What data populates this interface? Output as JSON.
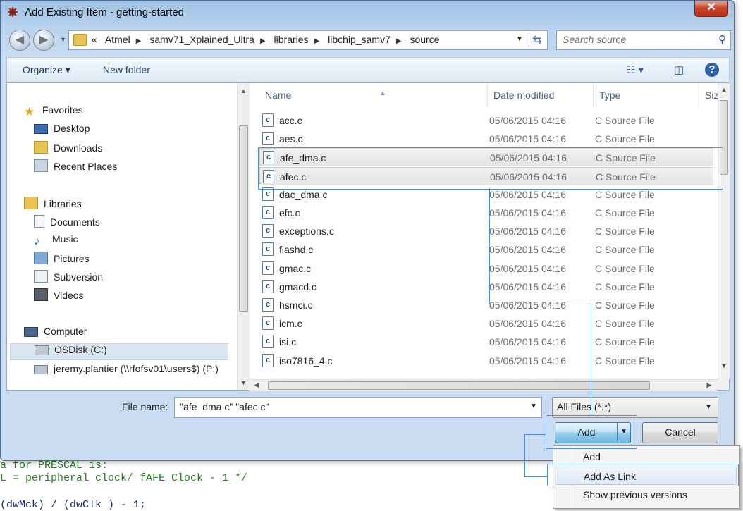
{
  "window": {
    "title": "Add Existing Item - getting-started",
    "close_glyph": "✕"
  },
  "nav": {
    "breadcrumbs": [
      "Atmel",
      "samv71_Xplained_Ultra",
      "libraries",
      "libchip_samv7",
      "source"
    ],
    "crumb_overflow": "«",
    "search_placeholder": "Search source"
  },
  "toolbar": {
    "organize": "Organize ▾",
    "new_folder": "New folder"
  },
  "sidebar": {
    "favorites": {
      "label": "Favorites",
      "items": [
        "Desktop",
        "Downloads",
        "Recent Places"
      ]
    },
    "libraries": {
      "label": "Libraries",
      "items": [
        "Documents",
        "Music",
        "Pictures",
        "Subversion",
        "Videos"
      ]
    },
    "computer": {
      "label": "Computer",
      "items": [
        "OSDisk (C:)",
        "jeremy.plantier (\\\\rfofsv01\\users$) (P:)"
      ]
    }
  },
  "columns": {
    "name": "Name",
    "date": "Date modified",
    "type": "Type",
    "size": "Siz"
  },
  "files": [
    {
      "name": "acc.c",
      "date": "05/06/2015 04:16",
      "type": "C Source File"
    },
    {
      "name": "aes.c",
      "date": "05/06/2015 04:16",
      "type": "C Source File"
    },
    {
      "name": "afe_dma.c",
      "date": "05/06/2015 04:16",
      "type": "C Source File"
    },
    {
      "name": "afec.c",
      "date": "05/06/2015 04:16",
      "type": "C Source File"
    },
    {
      "name": "dac_dma.c",
      "date": "05/06/2015 04:16",
      "type": "C Source File"
    },
    {
      "name": "efc.c",
      "date": "05/06/2015 04:16",
      "type": "C Source File"
    },
    {
      "name": "exceptions.c",
      "date": "05/06/2015 04:16",
      "type": "C Source File"
    },
    {
      "name": "flashd.c",
      "date": "05/06/2015 04:16",
      "type": "C Source File"
    },
    {
      "name": "gmac.c",
      "date": "05/06/2015 04:16",
      "type": "C Source File"
    },
    {
      "name": "gmacd.c",
      "date": "05/06/2015 04:16",
      "type": "C Source File"
    },
    {
      "name": "hsmci.c",
      "date": "05/06/2015 04:16",
      "type": "C Source File"
    },
    {
      "name": "icm.c",
      "date": "05/06/2015 04:16",
      "type": "C Source File"
    },
    {
      "name": "isi.c",
      "date": "05/06/2015 04:16",
      "type": "C Source File"
    },
    {
      "name": "iso7816_4.c",
      "date": "05/06/2015 04:16",
      "type": "C Source File"
    }
  ],
  "file_icon_letter": "c",
  "footer": {
    "file_name_label": "File name:",
    "file_name_value": "\"afe_dma.c\" \"afec.c\"",
    "filter": "All Files (*.*)",
    "add": "Add",
    "cancel": "Cancel"
  },
  "add_menu": [
    "Add",
    "Add As Link",
    "Show previous versions"
  ],
  "background_code": [
    "a for PRESCAL is:",
    "L = peripheral clock/ fAFE Clock - 1 */",
    "(dwMck) / (dwClk ) - 1;"
  ],
  "colors": {
    "annotation": "#4d8fd0",
    "selection": "#dbe6f3"
  }
}
